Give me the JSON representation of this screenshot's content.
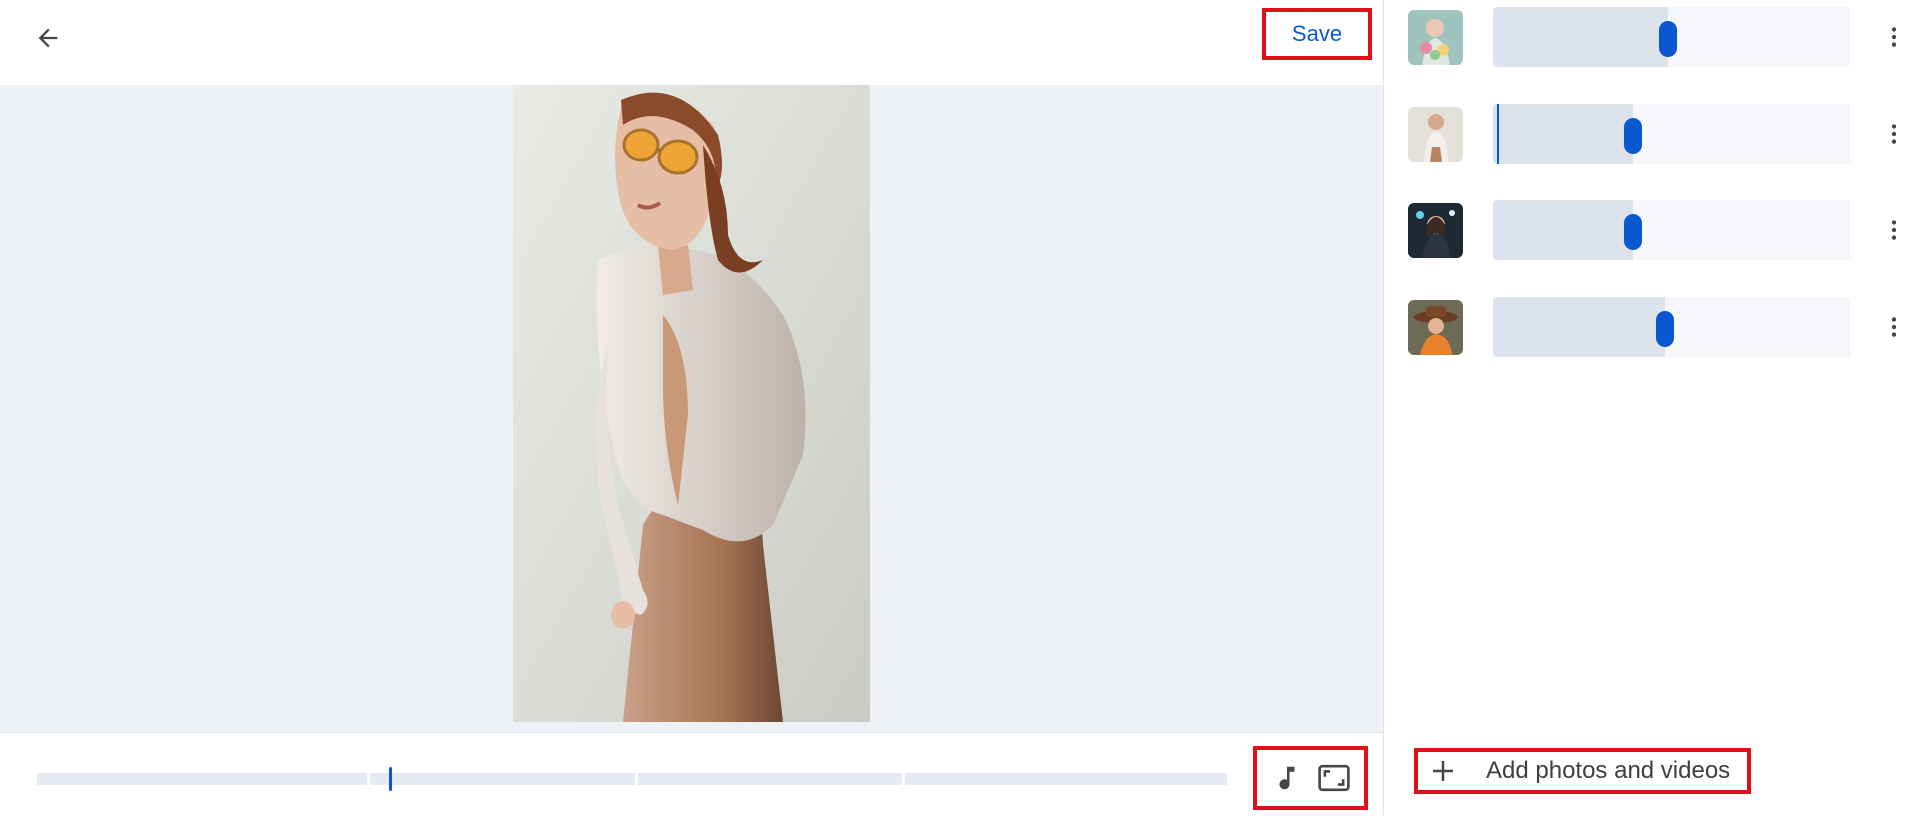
{
  "header": {
    "save_label": "Save"
  },
  "icons": {
    "back": "arrow-left-icon",
    "music": "music-note-icon",
    "aspect": "aspect-ratio-icon",
    "more": "more-vert-icon",
    "add": "plus-icon"
  },
  "colors": {
    "accent": "#0b57d0",
    "highlight_box": "#e0101a",
    "preview_bg": "#eef2f7"
  },
  "timeline": {
    "segments": 4,
    "playhead_fraction": 0.27
  },
  "clips": [
    {
      "thumbnail": "woman-with-floral-bouquet",
      "trim_fraction": 0.49,
      "start_marker": false
    },
    {
      "thumbnail": "woman-in-white-shirt",
      "trim_fraction": 0.39,
      "start_marker": true
    },
    {
      "thumbnail": "woman-with-neon-lights",
      "trim_fraction": 0.39,
      "start_marker": false
    },
    {
      "thumbnail": "woman-in-brown-hat",
      "trim_fraction": 0.48,
      "start_marker": false
    }
  ],
  "panel": {
    "add_label": "Add photos and videos"
  }
}
